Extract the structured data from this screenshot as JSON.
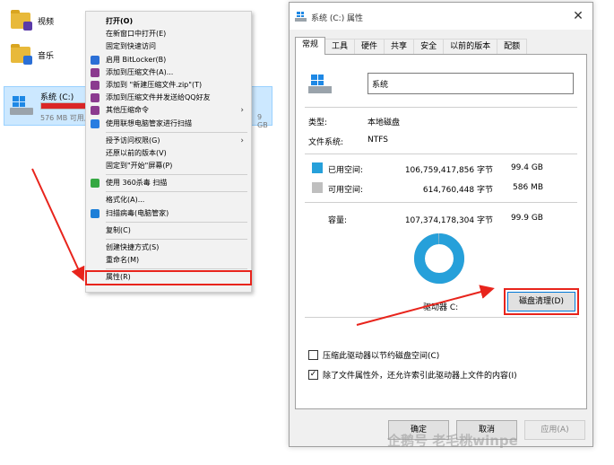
{
  "explorer": {
    "folders": [
      {
        "label": "视频",
        "icon": "video-folder-icon"
      },
      {
        "label": "音乐",
        "icon": "music-folder-icon"
      }
    ],
    "drive": {
      "name": "系统 (C:)",
      "free_text": "576 MB 可用,",
      "free_tail": "9 GB",
      "used_fraction": 0.994
    }
  },
  "context_menu": {
    "items": [
      {
        "label": "打开(O)",
        "bold": true,
        "icon": null
      },
      {
        "label": "在新窗口中打开(E)",
        "icon": null
      },
      {
        "label": "固定到快速访问",
        "icon": null
      },
      {
        "label": "启用 BitLocker(B)",
        "icon": "bitlocker-shield-icon"
      },
      {
        "label": "添加到压缩文件(A)...",
        "icon": "winrar-icon"
      },
      {
        "label": "添加到 \"新建压缩文件.zip\"(T)",
        "icon": "winrar-icon"
      },
      {
        "label": "添加到压缩文件并发送给QQ好友",
        "icon": "winrar-icon"
      },
      {
        "label": "其他压缩命令",
        "icon": "winrar-icon",
        "submenu": true
      },
      {
        "label": "使用联想电脑管家进行扫描",
        "icon": "lenovo-icon"
      },
      {
        "separator": true
      },
      {
        "label": "授予访问权限(G)",
        "icon": null,
        "submenu": true
      },
      {
        "label": "还原以前的版本(V)",
        "icon": null
      },
      {
        "label": "固定到\"开始\"屏幕(P)",
        "icon": null
      },
      {
        "separator": true
      },
      {
        "label": "使用 360杀毒 扫描",
        "icon": "360-shield-icon"
      },
      {
        "separator": true
      },
      {
        "label": "格式化(A)...",
        "icon": null
      },
      {
        "label": "扫描病毒(电脑管家)",
        "icon": "tencent-shield-icon"
      },
      {
        "separator": true
      },
      {
        "label": "复制(C)",
        "icon": null
      },
      {
        "separator": true
      },
      {
        "label": "创建快捷方式(S)",
        "icon": null
      },
      {
        "label": "重命名(M)",
        "icon": null
      },
      {
        "separator": true
      },
      {
        "label": "属性(R)",
        "icon": null,
        "highlight": true
      }
    ]
  },
  "dialog": {
    "title": "系统 (C:) 属性",
    "close": "✕",
    "tabs": [
      "常规",
      "工具",
      "硬件",
      "共享",
      "安全",
      "以前的版本",
      "配额"
    ],
    "active_tab": 0,
    "name_value": "系统",
    "type_label": "类型:",
    "type_value": "本地磁盘",
    "fs_label": "文件系统:",
    "fs_value": "NTFS",
    "used_label": "已用空间:",
    "used_bytes": "106,759,417,856 字节",
    "used_size": "99.4 GB",
    "free_label": "可用空间:",
    "free_bytes": "614,760,448 字节",
    "free_size": "586 MB",
    "capacity_label": "容量:",
    "capacity_bytes": "107,374,178,304 字节",
    "capacity_size": "99.9 GB",
    "drive_label": "驱动器 C:",
    "cleanup_button": "磁盘清理(D)",
    "compress_checkbox": "压缩此驱动器以节约磁盘空间(C)",
    "compress_checked": false,
    "index_checkbox": "除了文件属性外，还允许索引此驱动器上文件的内容(I)",
    "index_checked": true,
    "ok_button": "确定",
    "cancel_button": "取消",
    "apply_button": "应用(A)",
    "used_color": "#26a0da",
    "free_color": "#bfbfbf"
  },
  "watermark": "企鹅号 老毛桃winpe",
  "annotation_color": "#e8241c"
}
